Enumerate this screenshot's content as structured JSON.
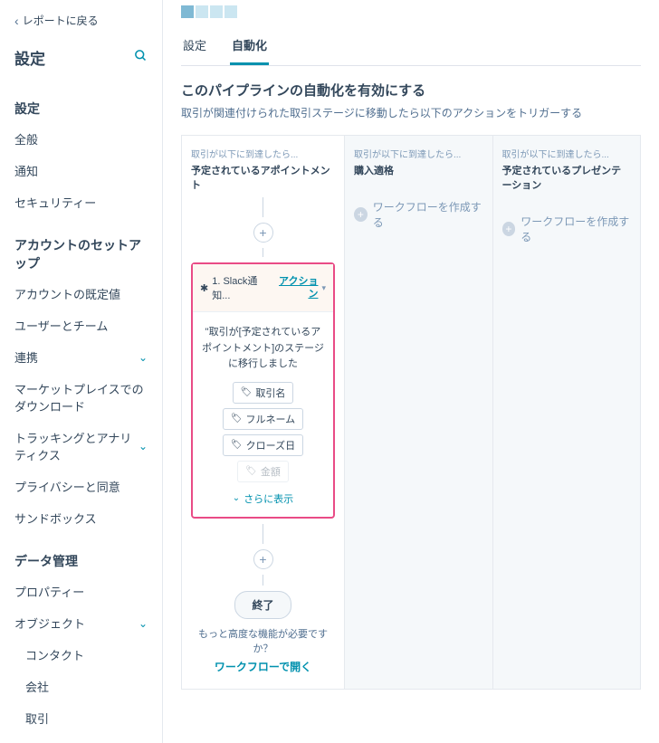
{
  "sidebar": {
    "back_label": "レポートに戻る",
    "title": "設定",
    "sections": [
      {
        "title": "設定",
        "items": [
          {
            "label": "全般"
          },
          {
            "label": "通知"
          },
          {
            "label": "セキュリティー"
          }
        ]
      },
      {
        "title": "アカウントのセットアップ",
        "items": [
          {
            "label": "アカウントの既定値"
          },
          {
            "label": "ユーザーとチーム"
          },
          {
            "label": "連携",
            "expandable": true
          },
          {
            "label": "マーケットプレイスでのダウンロード"
          },
          {
            "label": "トラッキングとアナリティクス",
            "expandable": true
          },
          {
            "label": "プライバシーと同意"
          },
          {
            "label": "サンドボックス"
          }
        ]
      },
      {
        "title": "データ管理",
        "items": [
          {
            "label": "プロパティー"
          },
          {
            "label": "オブジェクト",
            "expandable": true
          },
          {
            "label": "コンタクト",
            "sub": true
          },
          {
            "label": "会社",
            "sub": true
          },
          {
            "label": "取引",
            "sub": true
          }
        ]
      }
    ]
  },
  "tabs": {
    "settings": "設定",
    "automation": "自動化"
  },
  "section": {
    "heading": "このパイプラインの自動化を有効にする",
    "description": "取引が関連付けられた取引ステージに移動したら以下のアクションをトリガーする"
  },
  "columns": {
    "sublabel": "取引が以下に到達したら...",
    "col1_title": "予定されているアポイントメント",
    "col2_title": "購入適格",
    "col3_title": "予定されているプレゼンテーション",
    "create_workflow": "ワークフローを作成する"
  },
  "card": {
    "step_label": "1. Slack通知...",
    "action_link": "アクション",
    "message": "\"取引が[予定されているアポイントメント]のステージに移行しました",
    "tokens": [
      "取引名",
      "フルネーム",
      "クローズ日",
      "金額"
    ],
    "show_more": "さらに表示"
  },
  "end": {
    "label": "終了",
    "footer_text": "もっと高度な機能が必要ですか？",
    "footer_link": "ワークフローで開く"
  }
}
